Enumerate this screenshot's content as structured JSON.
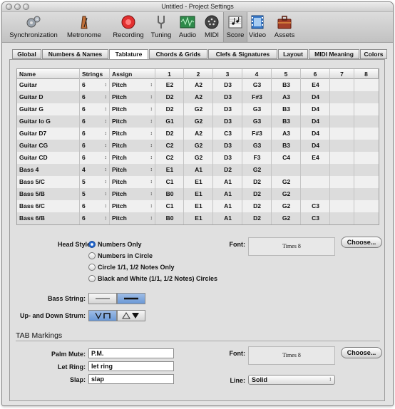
{
  "window": {
    "title": "Untitled - Project Settings"
  },
  "toolbar": {
    "items": [
      {
        "label": "Synchronization",
        "icon": "gears-icon"
      },
      {
        "label": "Metronome",
        "icon": "metronome-icon"
      },
      {
        "label": "Recording",
        "icon": "record-icon"
      },
      {
        "label": "Tuning",
        "icon": "tuning-fork-icon"
      },
      {
        "label": "Audio",
        "icon": "audio-icon"
      },
      {
        "label": "MIDI",
        "icon": "midi-icon"
      },
      {
        "label": "Score",
        "icon": "score-icon",
        "selected": true
      },
      {
        "label": "Video",
        "icon": "video-icon"
      },
      {
        "label": "Assets",
        "icon": "assets-icon"
      }
    ]
  },
  "tabs": [
    "Global",
    "Numbers & Names",
    "Tablature",
    "Chords & Grids",
    "Clefs & Signatures",
    "Layout",
    "MIDI Meaning",
    "Colors"
  ],
  "active_tab": "Tablature",
  "table": {
    "headers": [
      "Name",
      "Strings",
      "Assign",
      "1",
      "2",
      "3",
      "4",
      "5",
      "6",
      "7",
      "8"
    ],
    "rows": [
      {
        "name": "Guitar",
        "strings": "6",
        "assign": "Pitch",
        "notes": [
          "E2",
          "A2",
          "D3",
          "G3",
          "B3",
          "E4",
          "",
          ""
        ]
      },
      {
        "name": "Guitar D",
        "strings": "6",
        "assign": "Pitch",
        "notes": [
          "D2",
          "A2",
          "D3",
          "F#3",
          "A3",
          "D4",
          "",
          ""
        ]
      },
      {
        "name": "Guitar G",
        "strings": "6",
        "assign": "Pitch",
        "notes": [
          "D2",
          "G2",
          "D3",
          "G3",
          "B3",
          "D4",
          "",
          ""
        ]
      },
      {
        "name": "Guitar lo G",
        "strings": "6",
        "assign": "Pitch",
        "notes": [
          "G1",
          "G2",
          "D3",
          "G3",
          "B3",
          "D4",
          "",
          ""
        ]
      },
      {
        "name": "Guitar D7",
        "strings": "6",
        "assign": "Pitch",
        "notes": [
          "D2",
          "A2",
          "C3",
          "F#3",
          "A3",
          "D4",
          "",
          ""
        ]
      },
      {
        "name": "Guitar CG",
        "strings": "6",
        "assign": "Pitch",
        "notes": [
          "C2",
          "G2",
          "D3",
          "G3",
          "B3",
          "D4",
          "",
          ""
        ]
      },
      {
        "name": "Guitar CD",
        "strings": "6",
        "assign": "Pitch",
        "notes": [
          "C2",
          "G2",
          "D3",
          "F3",
          "C4",
          "E4",
          "",
          ""
        ]
      },
      {
        "name": "Bass 4",
        "strings": "4",
        "assign": "Pitch",
        "notes": [
          "E1",
          "A1",
          "D2",
          "G2",
          "",
          "",
          "",
          ""
        ]
      },
      {
        "name": "Bass 5/C",
        "strings": "5",
        "assign": "Pitch",
        "notes": [
          "C1",
          "E1",
          "A1",
          "D2",
          "G2",
          "",
          "",
          ""
        ]
      },
      {
        "name": "Bass 5/B",
        "strings": "5",
        "assign": "Pitch",
        "notes": [
          "B0",
          "E1",
          "A1",
          "D2",
          "G2",
          "",
          "",
          ""
        ]
      },
      {
        "name": "Bass 6/C",
        "strings": "6",
        "assign": "Pitch",
        "notes": [
          "C1",
          "E1",
          "A1",
          "D2",
          "G2",
          "C3",
          "",
          ""
        ]
      },
      {
        "name": "Bass 6/B",
        "strings": "6",
        "assign": "Pitch",
        "notes": [
          "B0",
          "E1",
          "A1",
          "D2",
          "G2",
          "C3",
          "",
          ""
        ]
      }
    ]
  },
  "head_style": {
    "label": "Head Style:",
    "options": [
      "Numbers Only",
      "Numbers in Circle",
      "Circle 1/1, 1/2 Notes Only",
      "Black and White (1/1, 1/2 Notes) Circles"
    ],
    "selected": "Numbers Only"
  },
  "font1": {
    "label": "Font:",
    "value": "Times 8",
    "button": "Choose..."
  },
  "bass_string": {
    "label": "Bass String:",
    "selected_index": 1
  },
  "strum": {
    "label": "Up- and Down Strum:",
    "selected_index": 0
  },
  "tab_markings": {
    "title": "TAB Markings",
    "palm_mute": {
      "label": "Palm Mute:",
      "value": "P.M."
    },
    "let_ring": {
      "label": "Let Ring:",
      "value": "let ring"
    },
    "slap": {
      "label": "Slap:",
      "value": "slap"
    },
    "font": {
      "label": "Font:",
      "value": "Times 8",
      "button": "Choose..."
    },
    "line": {
      "label": "Line:",
      "value": "Solid"
    }
  }
}
